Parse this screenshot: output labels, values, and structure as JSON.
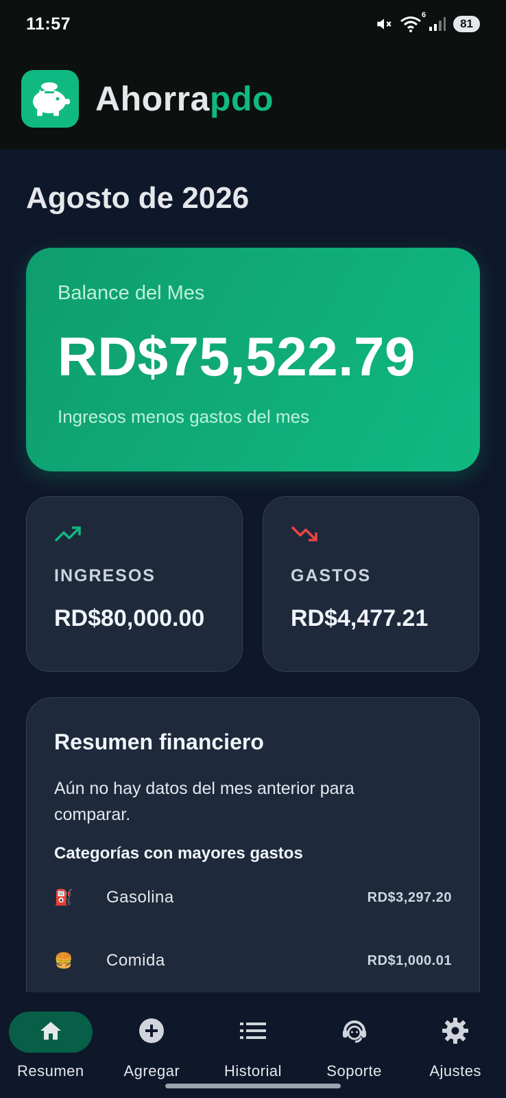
{
  "status_bar": {
    "time": "11:57",
    "battery": "81",
    "network_badge": "6",
    "icons": [
      "mute-icon",
      "wifi-icon",
      "signal-icon",
      "battery-icon"
    ]
  },
  "app": {
    "title_part1": "Ahorra",
    "title_part2": "pdo",
    "logo_icon": "piggy-bank-icon",
    "accent_color": "#10b981"
  },
  "page": {
    "title": "Agosto de 2026"
  },
  "balance": {
    "label": "Balance del Mes",
    "amount": "RD$75,522.79",
    "subtitle": "Ingresos menos gastos del mes"
  },
  "income": {
    "icon": "trending-up-icon",
    "label": "INGRESOS",
    "amount": "RD$80,000.00",
    "color": "#10b981"
  },
  "expenses": {
    "icon": "trending-down-icon",
    "label": "GASTOS",
    "amount": "RD$4,477.21",
    "color": "#ef4444"
  },
  "summary": {
    "title": "Resumen financiero",
    "message": "Aún no hay datos del mes anterior para comparar.",
    "categories_title": "Categorías con mayores gastos",
    "categories": [
      {
        "icon": "⛽",
        "name": "Gasolina",
        "amount": "RD$3,297.20"
      },
      {
        "icon": "🍔",
        "name": "Comida",
        "amount": "RD$1,000.01"
      }
    ]
  },
  "nav": {
    "items": [
      {
        "label": "Resumen",
        "icon": "home-icon",
        "active": true
      },
      {
        "label": "Agregar",
        "icon": "add-circle-icon",
        "active": false
      },
      {
        "label": "Historial",
        "icon": "list-icon",
        "active": false
      },
      {
        "label": "Soporte",
        "icon": "support-agent-icon",
        "active": false
      },
      {
        "label": "Ajustes",
        "icon": "gear-icon",
        "active": false
      }
    ]
  }
}
